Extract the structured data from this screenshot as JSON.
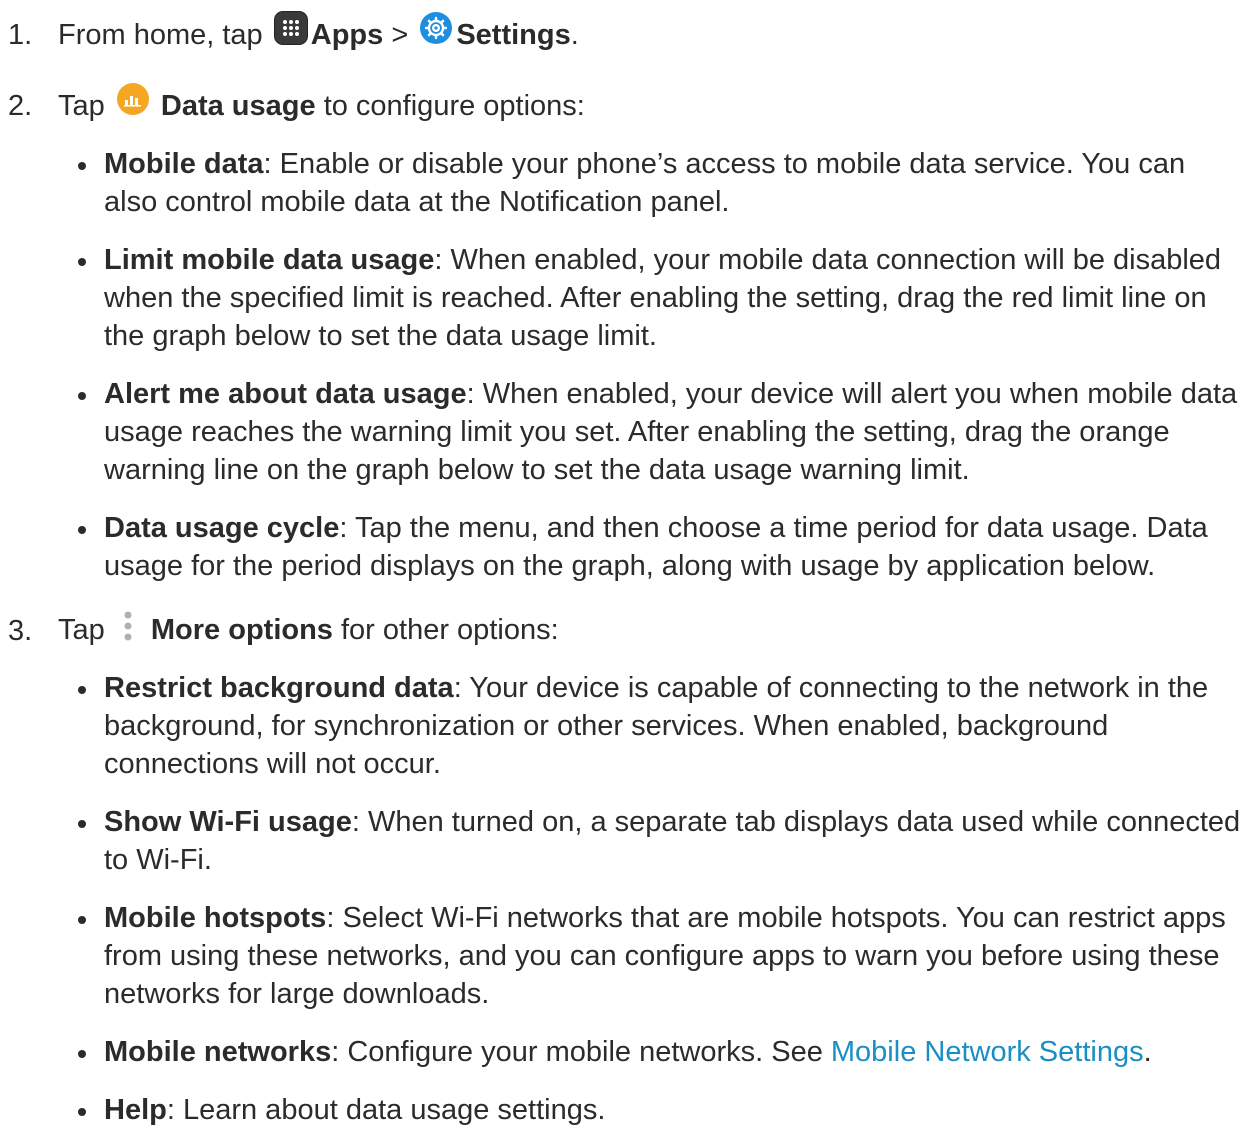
{
  "steps": [
    {
      "num": "1.",
      "pre": "From home, tap",
      "b1": "Apps",
      "sep": ">",
      "b2": "Settings",
      "post": "."
    },
    {
      "num": "2.",
      "pre": "Tap",
      "b1": "Data usage",
      "post": "to configure options:"
    },
    {
      "num": "3.",
      "pre": "Tap",
      "b1": "More options",
      "post": "for other options:"
    }
  ],
  "data_usage_items": [
    {
      "term": "Mobile data",
      "text": ": Enable or disable your phone’s access to mobile data service. You can also control mobile data at the Notification panel."
    },
    {
      "term": "Limit mobile data usage",
      "text": ": When enabled, your mobile data connection will be disabled when the specified limit is reached. After enabling the setting, drag the red limit line on the graph below to set the data usage limit."
    },
    {
      "term": "Alert me about data usage",
      "text": ": When enabled, your device will alert you when mobile data usage reaches the warning limit you set. After enabling the setting, drag the orange warning line on the graph below to set the data usage warning limit."
    },
    {
      "term": "Data usage cycle",
      "text": ": Tap the menu, and then choose a time period for data usage. Data usage for the period displays on the graph, along with usage by application below."
    }
  ],
  "more_options_items": [
    {
      "term": "Restrict background data",
      "text": ": Your device is capable of connecting to the network in the background, for synchronization or other services. When enabled, background connections will not occur."
    },
    {
      "term": "Show Wi-Fi usage",
      "text": ": When turned on, a separate tab displays data used while connected to Wi-Fi."
    },
    {
      "term": "Mobile hotspots",
      "text": ": Select Wi-Fi networks that are mobile hotspots. You can restrict apps from using these networks, and you can configure apps to warn you before using these networks for large downloads."
    },
    {
      "term": "Mobile networks",
      "text": ": Configure your mobile networks. See ",
      "link": "Mobile Network Settings",
      "after": "."
    },
    {
      "term": "Help",
      "text": ": Learn about data usage settings."
    }
  ],
  "colors": {
    "link": "#1a8fc4",
    "settings_icon": "#1e8fe0",
    "data_icon": "#f5a623",
    "apps_icon": "#3a3a3a"
  },
  "icons": [
    "apps-icon",
    "settings-icon",
    "data-usage-icon",
    "more-options-icon"
  ]
}
